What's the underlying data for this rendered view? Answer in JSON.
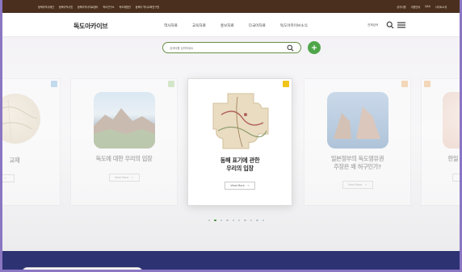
{
  "topbar": {
    "left_links": [
      "동북아역사재단",
      "동북아역사넷",
      "동북아역사자료센터",
      "독도연구소",
      "독도체험관",
      "동북아 역사교육연구원"
    ],
    "right_links": [
      "공지사항",
      "이용안내",
      "Q&A",
      "사이트소개"
    ]
  },
  "header": {
    "logo": "독도아카이브",
    "nav": [
      "역사자료",
      "교육자료",
      "홍보자료",
      "다국어자료",
      "독도아카이브소식"
    ],
    "lang_label": "전체검색"
  },
  "search": {
    "placeholder": "검색어를 입력하세요"
  },
  "cards": [
    {
      "title": "교재",
      "more": "",
      "badge_color": "#7eb6e0"
    },
    {
      "title": "독도에 대한 우리의 입장",
      "more": "View More",
      "badge_color": "#a9d58a"
    },
    {
      "title_line1": "동해 표기에 관한",
      "title_line2": "우리의 입장",
      "more": "View More",
      "badge_color": "#f0c419"
    },
    {
      "title_line1": "일본정부의 독도영유권",
      "title_line2": "주장은 왜 허구인가?",
      "more": "View More",
      "badge_color": "#f1b062"
    },
    {
      "title": "한일 역사",
      "more": "",
      "badge_color": "#f1b062"
    }
  ],
  "pagination": {
    "count": 10,
    "active": 1
  },
  "colors": {
    "topbar": "#4a2f1e",
    "accent_green": "#4fa64a",
    "footer": "#2d3272"
  }
}
